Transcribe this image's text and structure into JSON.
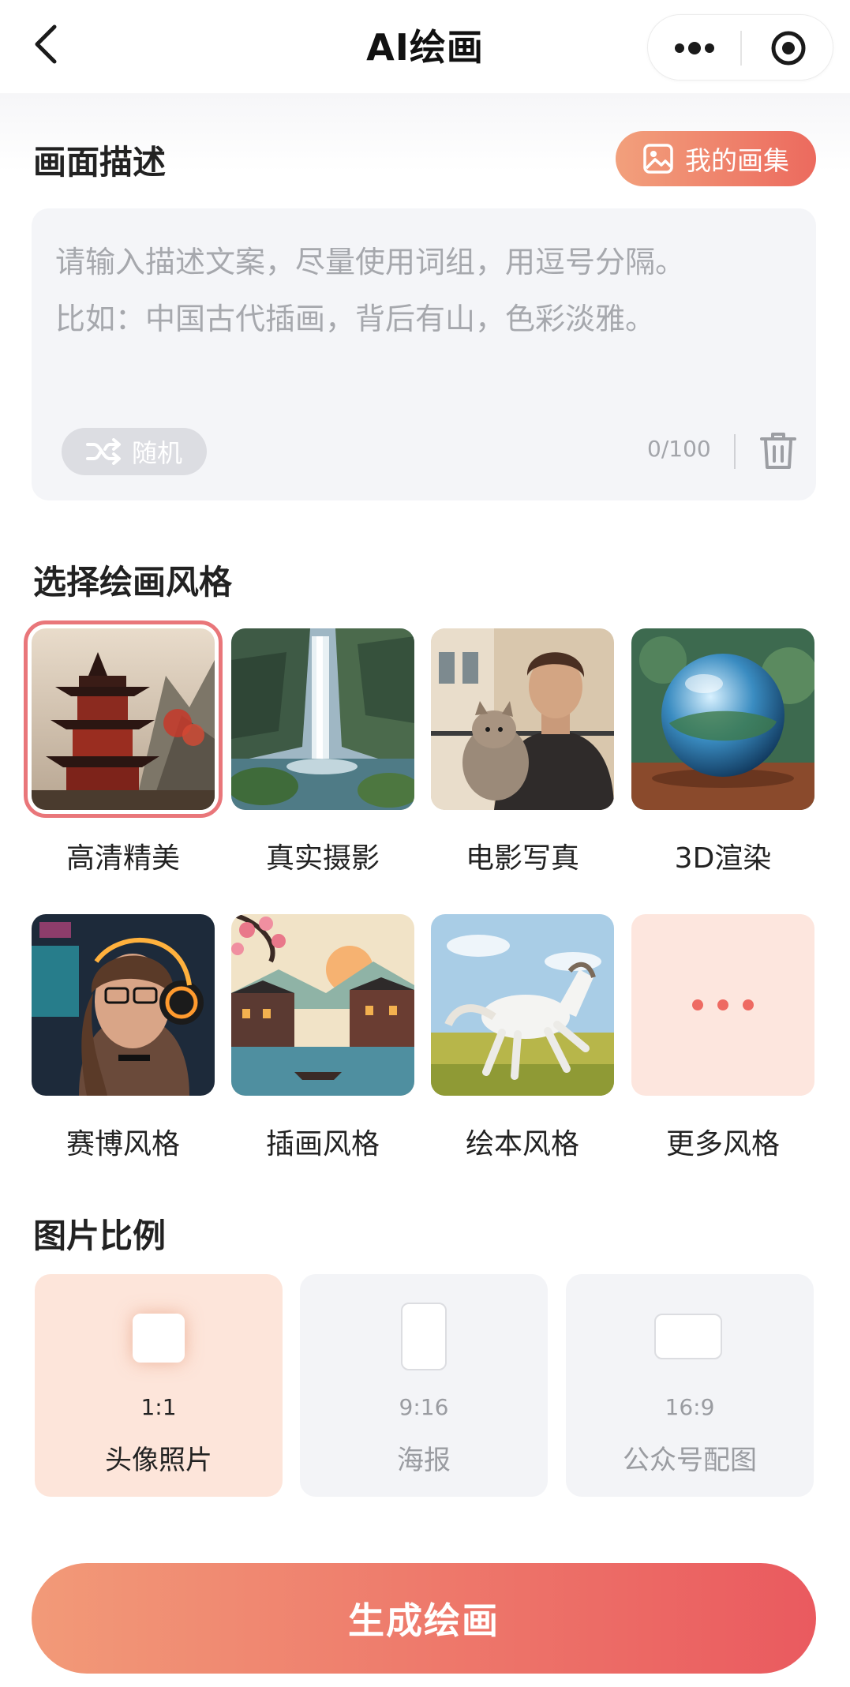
{
  "nav": {
    "title": "AI绘画",
    "back_icon": "chevron-left-icon",
    "more_icon": "more-dots-icon",
    "close_icon": "target-circle-icon"
  },
  "description": {
    "section_title": "画面描述",
    "gallery_button": "我的画集",
    "gallery_icon": "image-icon",
    "placeholder": "请输入描述文案，尽量使用词组，用逗号分隔。\n比如：中国古代插画，背后有山，色彩淡雅。",
    "value": "",
    "random_button": "随机",
    "random_icon": "shuffle-icon",
    "char_count": "0/100",
    "trash_icon": "trash-icon"
  },
  "styles": {
    "section_title": "选择绘画风格",
    "selected_index": 0,
    "items": [
      {
        "label": "高清精美",
        "thumb": "pagoda-landscape"
      },
      {
        "label": "真实摄影",
        "thumb": "waterfall-photo"
      },
      {
        "label": "电影写真",
        "thumb": "man-with-cat"
      },
      {
        "label": "3D渲染",
        "thumb": "glass-sphere"
      },
      {
        "label": "赛博风格",
        "thumb": "cyber-girl-headphones"
      },
      {
        "label": "插画风格",
        "thumb": "watertown-illustration"
      },
      {
        "label": "绘本风格",
        "thumb": "white-horse"
      },
      {
        "label": "更多风格",
        "thumb": "more-dots"
      }
    ]
  },
  "ratio": {
    "section_title": "图片比例",
    "selected_index": 0,
    "items": [
      {
        "value": "1:1",
        "label": "头像照片"
      },
      {
        "value": "9:16",
        "label": "海报"
      },
      {
        "value": "16:9",
        "label": "公众号配图"
      }
    ]
  },
  "generate_button": "生成绘画",
  "colors": {
    "accent_start": "#f29a78",
    "accent_end": "#ea5a5f",
    "selected_outline": "#e9767a",
    "card_bg": "#f3f4f7",
    "active_card_bg": "#fde5da"
  }
}
